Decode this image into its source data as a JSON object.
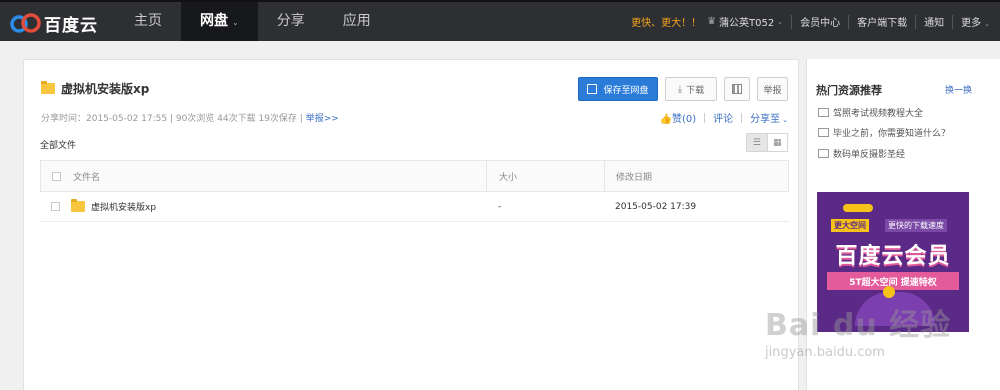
{
  "header": {
    "logo_text": "百度云",
    "nav": [
      {
        "label": "主页",
        "active": false
      },
      {
        "label": "网盘",
        "active": true,
        "caret": "⌄"
      },
      {
        "label": "分享",
        "active": false
      },
      {
        "label": "应用",
        "active": false
      }
    ],
    "promo": "更快、更大！！",
    "username": "蒲公英T052",
    "links": [
      "会员中心",
      "客户端下载",
      "通知",
      "更多"
    ],
    "caret": "⌄"
  },
  "share": {
    "title": "虚拟机安装版xp",
    "meta": "分享时间：2015-05-02 17:55 | 90次浏览 44次下载 19次保存 |",
    "report_link": "举报>>",
    "buttons": {
      "save": "保存至网盘",
      "download": "下载",
      "report": "举报"
    },
    "social": {
      "like": "赞(0)",
      "comment": "评论",
      "share_to": "分享至"
    }
  },
  "files": {
    "section_label": "全部文件",
    "columns": [
      "文件名",
      "大小",
      "修改日期"
    ],
    "rows": [
      {
        "name": "虚拟机安装版xp",
        "size": "-",
        "modified": "2015-05-02 17:39"
      }
    ]
  },
  "sidebar": {
    "heading": "热门资源推荐",
    "refresh": "换一换",
    "resources": [
      "驾照考试视频教程大全",
      "毕业之前，你需要知道什么？",
      "数码单反摄影圣经"
    ],
    "banner": {
      "tag1": "更大空间",
      "tag2": "更快的下载速度",
      "headline": "百度云会员",
      "subline": "5T超大空间  提速特权"
    }
  },
  "watermark": {
    "text": "Bai du 经验",
    "url": "jingyan.baidu.com"
  },
  "colors": {
    "topbar": "#2d2f33",
    "primary": "#2b7cd9",
    "link": "#3b6fc4",
    "promo": "#f5a31a",
    "banner": "#5b2a87"
  }
}
